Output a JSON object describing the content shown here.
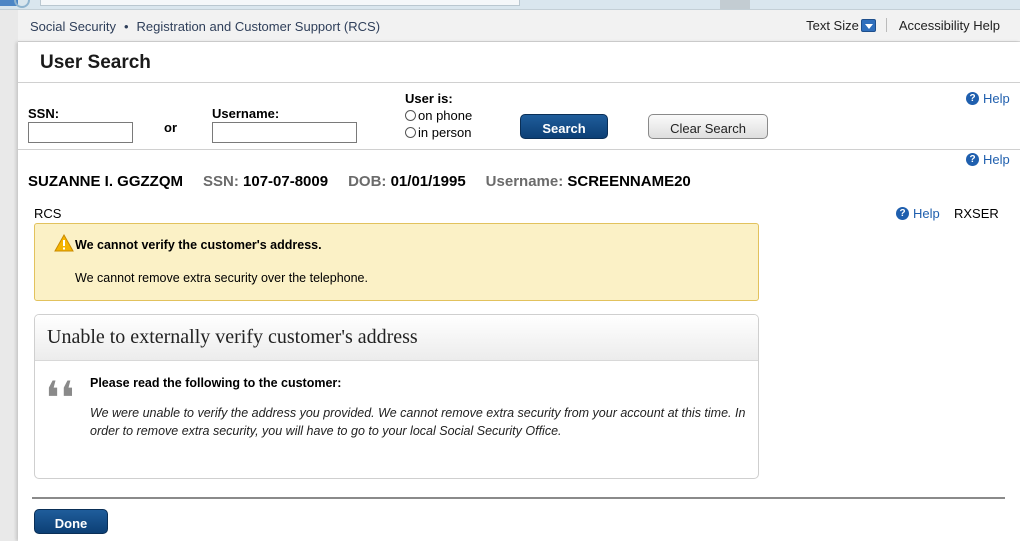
{
  "header": {
    "crumb_1": "Social Security",
    "crumb_sep": "•",
    "crumb_2": "Registration and Customer Support (RCS)",
    "text_size_label": "Text Size",
    "accessibility_label": "Accessibility Help"
  },
  "page": {
    "title": "User Search"
  },
  "search": {
    "ssn_label": "SSN:",
    "ssn_value": "",
    "or_label": "or",
    "username_label": "Username:",
    "username_value": "",
    "user_is_label": "User is:",
    "radio_phone": "on phone",
    "radio_person": "in person",
    "search_button": "Search",
    "clear_button": "Clear Search",
    "help_label": "Help"
  },
  "customer": {
    "name": "SUZANNE I. GGZZQM",
    "ssn_key": "SSN:",
    "ssn_value": "107-07-8009",
    "dob_key": "DOB:",
    "dob_value": "01/01/1995",
    "username_key": "Username:",
    "username_value": "SCREENNAME20",
    "help_label": "Help"
  },
  "section": {
    "left_label": "RCS",
    "help_label": "Help",
    "code": "RXSER"
  },
  "warning": {
    "title": "We cannot verify the customer's address.",
    "body": "We cannot remove extra security over the telephone."
  },
  "card": {
    "title": "Unable to externally verify customer's address",
    "quote_title": "Please read the following to the customer:",
    "quote_body": "We were unable to verify the address you provided. We cannot remove extra security from your account at this time. In order to remove extra security, you will have to go to your local Social Security Office."
  },
  "footer": {
    "done_button": "Done"
  },
  "icons": {
    "help": "question-circle-icon",
    "warning": "warning-triangle-icon",
    "quote": "quote-icon",
    "dropdown": "chevron-down-icon"
  },
  "colors": {
    "primary_button": "#0c3f75",
    "warning_bg": "#fbf1c6",
    "warning_border": "#e2c25d",
    "help_link": "#1f5fae"
  }
}
